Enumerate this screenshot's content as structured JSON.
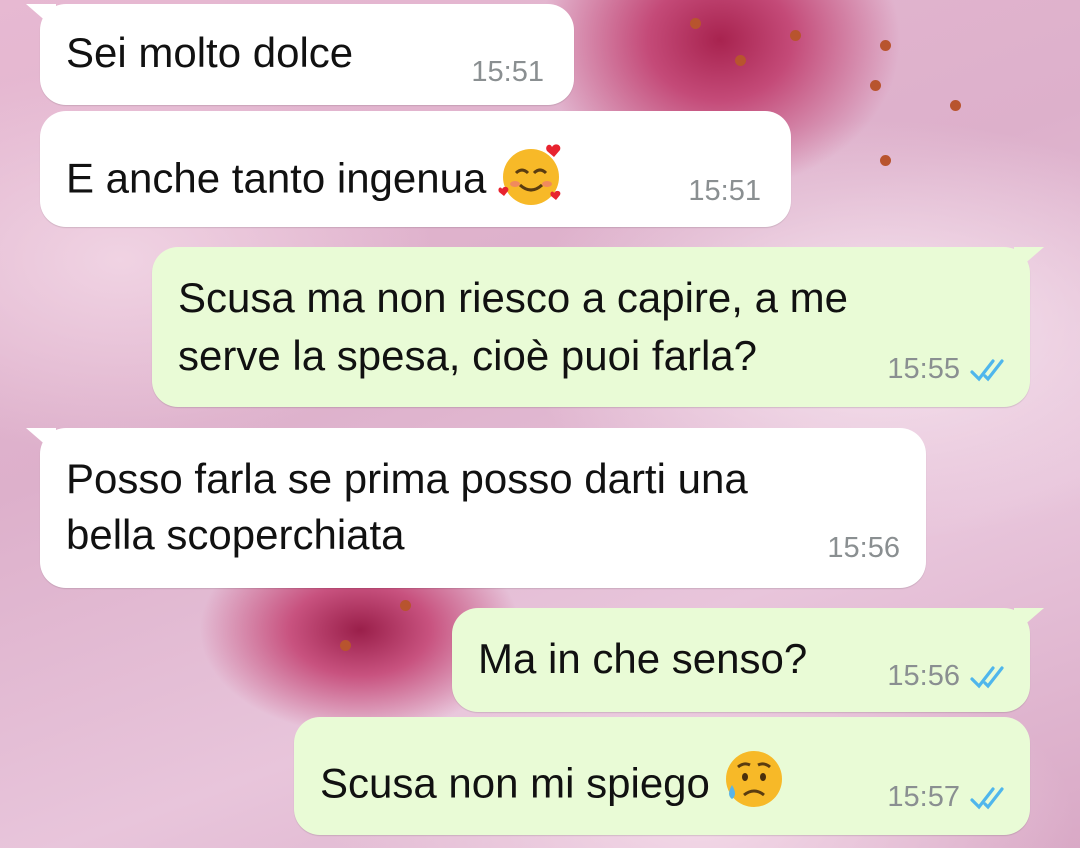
{
  "messages": [
    {
      "direction": "incoming",
      "text": "Sei molto dolce",
      "time": "15:51"
    },
    {
      "direction": "incoming",
      "text": "E anche tanto ingenua",
      "emoji": "smiling-face-with-hearts",
      "time": "15:51"
    },
    {
      "direction": "outgoing",
      "lines": [
        "Scusa ma non riesco a capire, a me",
        "serve la spesa, cioè puoi farla?"
      ],
      "time": "15:55",
      "status": "read"
    },
    {
      "direction": "incoming",
      "lines": [
        "Posso farla se prima posso darti una",
        "bella scoperchiata"
      ],
      "time": "15:56"
    },
    {
      "direction": "outgoing",
      "text": "Ma in che senso?",
      "time": "15:56",
      "status": "read"
    },
    {
      "direction": "outgoing",
      "text": "Scusa non mi spiego",
      "emoji": "sad-but-relieved-face",
      "time": "15:57",
      "status": "read"
    }
  ],
  "colors": {
    "incoming_bubble": "#ffffff",
    "outgoing_bubble": "#e9fbd6",
    "read_ticks": "#4fb6ec",
    "timestamp": "#8a8f91"
  }
}
